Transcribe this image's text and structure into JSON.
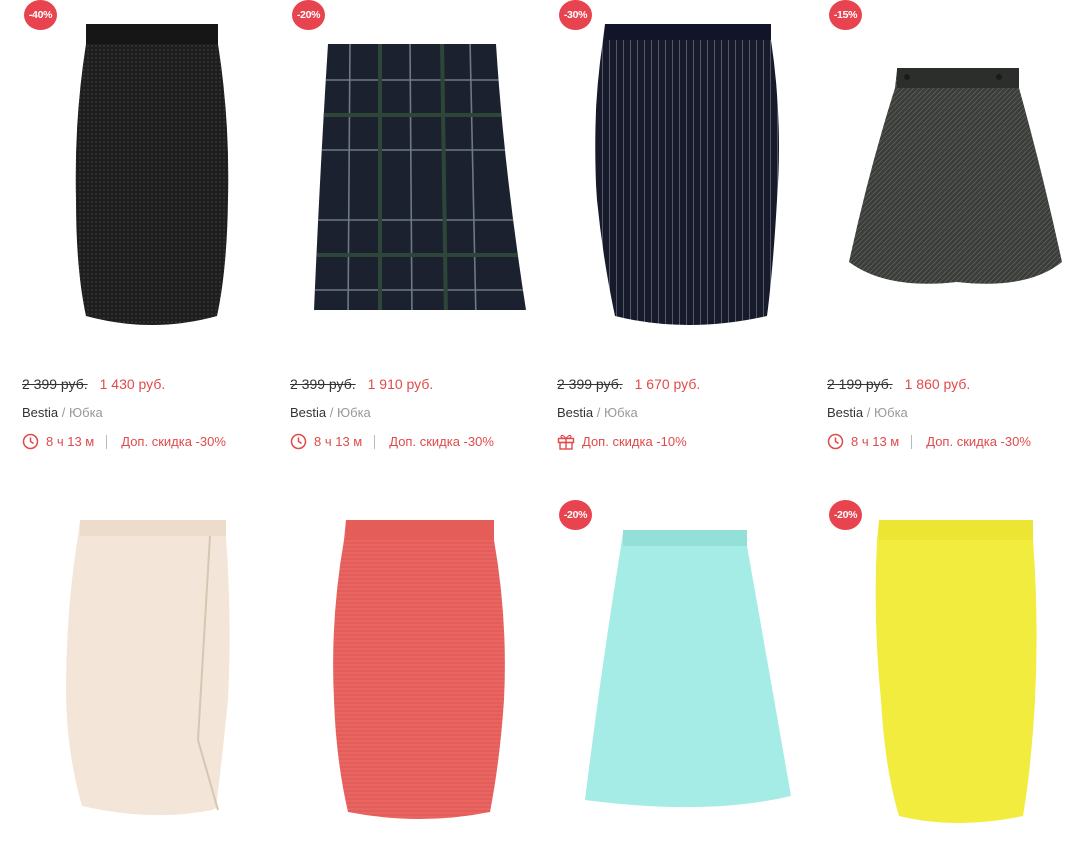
{
  "products": [
    {
      "badge": "-40%",
      "old_price": "2 399 руб.",
      "new_price": "1 430 руб.",
      "brand": "Bestia",
      "category": "/ Юбка",
      "timer": "8 ч 13 м",
      "extra": "Доп. скидка -30%"
    },
    {
      "badge": "-20%",
      "old_price": "2 399 руб.",
      "new_price": "1 910 руб.",
      "brand": "Bestia",
      "category": "/ Юбка",
      "timer": "8 ч 13 м",
      "extra": "Доп. скидка -30%"
    },
    {
      "badge": "-30%",
      "old_price": "2 399 руб.",
      "new_price": "1 670 руб.",
      "brand": "Bestia",
      "category": "/ Юбка",
      "gift": "Доп. скидка -10%"
    },
    {
      "badge": "-15%",
      "old_price": "2 199 руб.",
      "new_price": "1 860 руб.",
      "brand": "Bestia",
      "category": "/ Юбка",
      "timer": "8 ч 13 м",
      "extra": "Доп. скидка -30%"
    },
    {},
    {},
    {
      "badge": "-20%"
    },
    {
      "badge": "-20%"
    }
  ],
  "colors": {
    "badge": "#e8444f",
    "price_new": "#e04a4a",
    "category": "#999999"
  },
  "icons": {
    "timer": "clock-icon",
    "gift": "gift-icon"
  }
}
